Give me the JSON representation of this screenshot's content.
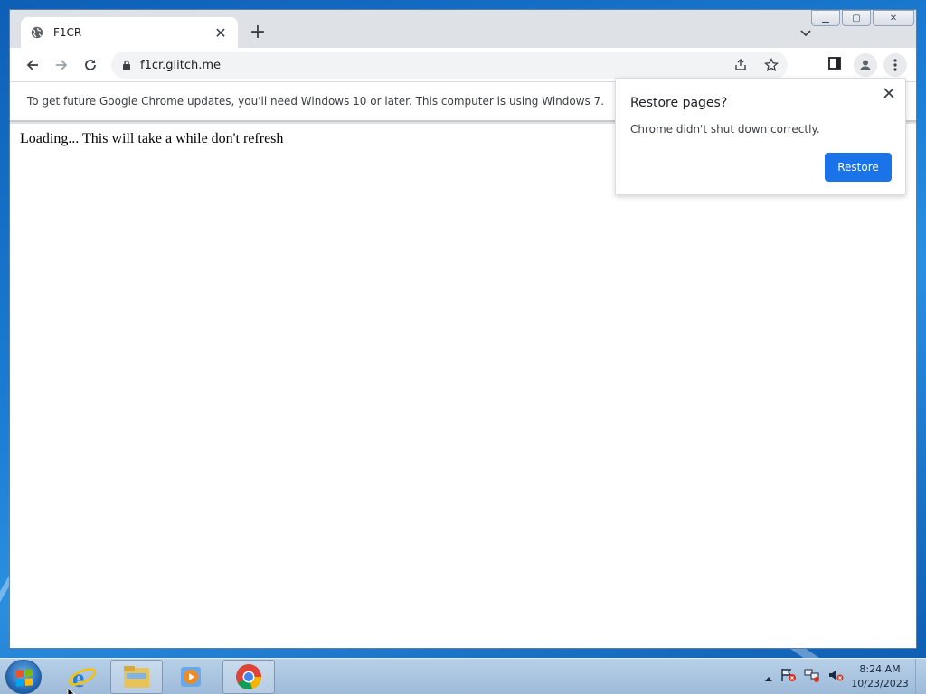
{
  "window": {
    "tab": {
      "title": "F1CR"
    },
    "omnibox": {
      "url": "f1cr.glitch.me"
    },
    "infobar": {
      "text": "To get future Google Chrome updates, you'll need Windows 10 or later. This computer is using Windows 7."
    },
    "content": {
      "text": "Loading... This will take a while don't refresh"
    }
  },
  "restore_bubble": {
    "title": "Restore pages?",
    "body": "Chrome didn't shut down correctly.",
    "button_label": "Restore"
  },
  "taskbar": {
    "pinned": [
      "internet-explorer-icon",
      "windows-explorer-icon",
      "media-player-icon",
      "chrome-icon"
    ],
    "clock": {
      "time": "8:24 AM",
      "date": "10/23/2023"
    }
  },
  "colors": {
    "accent": "#1a73e8",
    "desktop": "#1d7fd6"
  }
}
